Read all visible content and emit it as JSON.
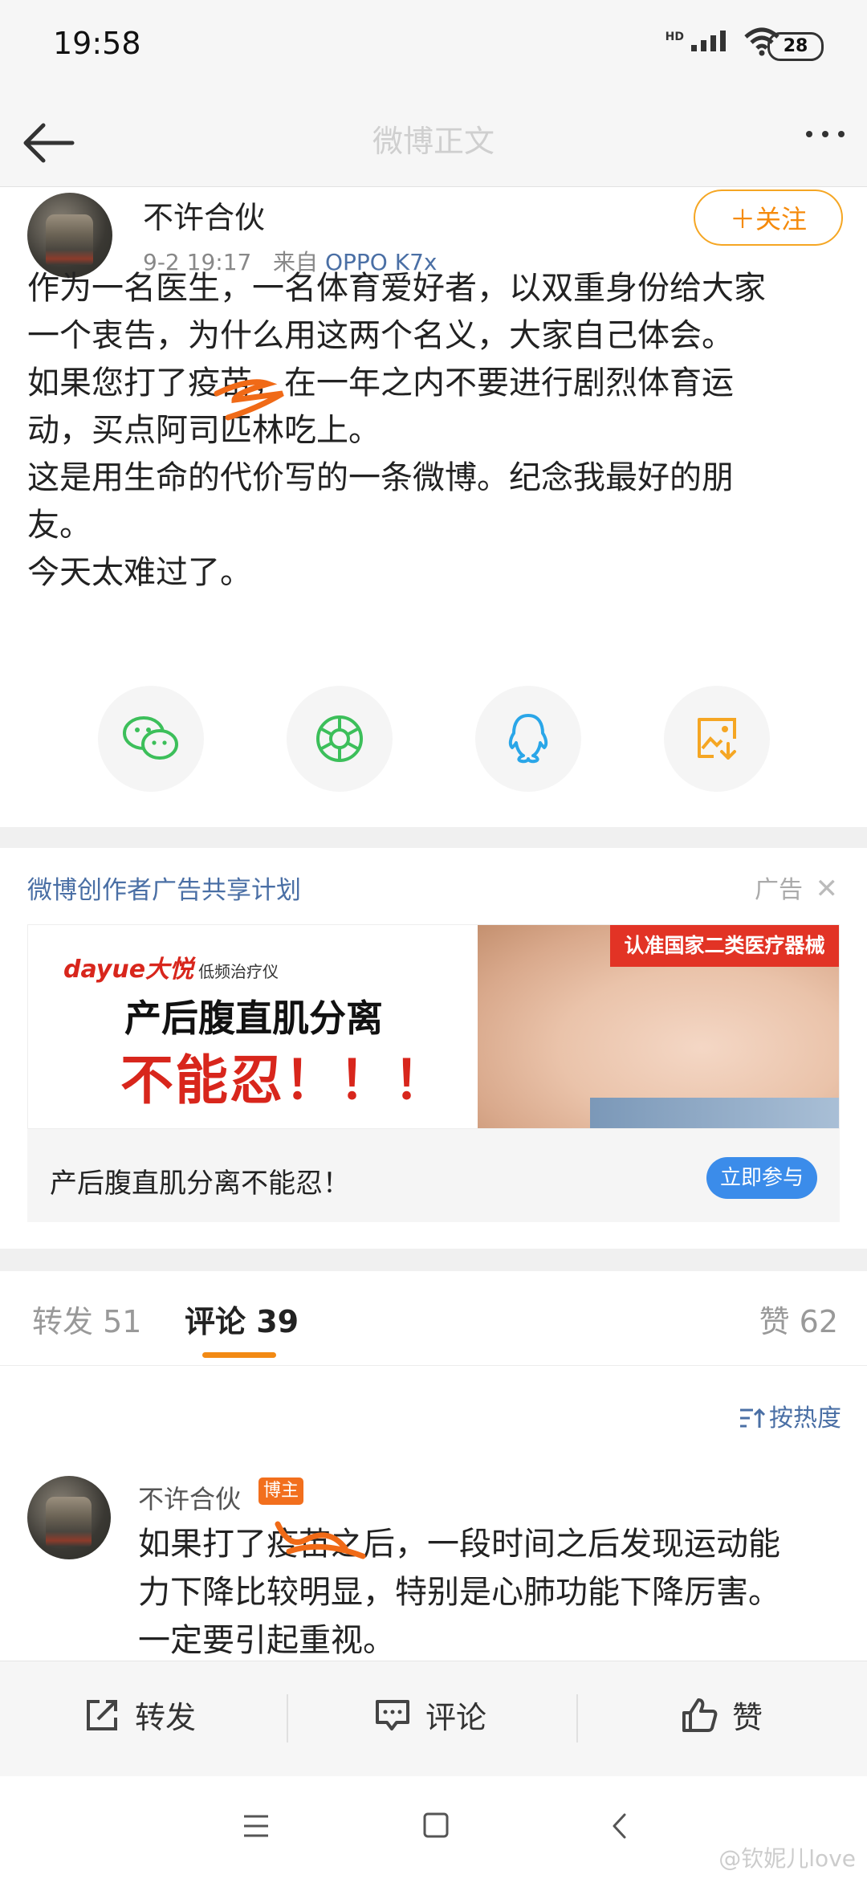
{
  "status_bar": {
    "time": "19:58",
    "network": "HD",
    "battery": "28"
  },
  "nav": {
    "title": "微博正文"
  },
  "post": {
    "author": "不许合伙",
    "date": "9-2 19:17",
    "source_prefix": "来自",
    "device": "OPPO K7x",
    "follow_label": "＋关注",
    "text": "作为一名医生，一名体育爱好者，以双重身份给大家\n一个衷告，为什么用这两个名义，大家自己体会。\n如果您打了疫苗，在一年之内不要进行剧烈体育运\n动，买点阿司匹林吃上。\n这是用生命的代价写的一条微博。纪念我最好的朋\n友。\n今天太难过了。"
  },
  "share": [
    {
      "icon": "wechat-icon",
      "color": "#3cbf5a"
    },
    {
      "icon": "moments-icon",
      "color": "#3cbf5a"
    },
    {
      "icon": "qq-icon",
      "color": "#2aa6e8"
    },
    {
      "icon": "save-image-icon",
      "color": "#f5a623"
    }
  ],
  "ad": {
    "header": "微博创作者广告共享计划",
    "tag": "广告",
    "brand": "dayue大悦",
    "brand_sub": "低频治疗仪",
    "title": "产后腹直肌分离",
    "slogan": "不能忍！！！",
    "red_tag": "认准国家二类医疗器械",
    "caption": "产后腹直肌分离不能忍！",
    "cta": "立即参与"
  },
  "tabs": {
    "repost": "转发 51",
    "comments": "评论 39",
    "likes": "赞 62",
    "sort": "按热度"
  },
  "comment": {
    "author": "不许合伙",
    "badge": "博主",
    "text": "如果打了疫苗之后，一段时间之后发现运动能\n力下降比较明显，特别是心肺功能下降厉害。\n一定要引起重视。"
  },
  "actions": {
    "repost": "转发",
    "comment": "评论",
    "like": "赞"
  },
  "watermark": "@钦妮儿love",
  "colors": {
    "accent_orange": "#f28a14",
    "link_blue": "#4a6fa5",
    "cta_blue": "#3b8cea",
    "ad_red": "#d8261c"
  }
}
